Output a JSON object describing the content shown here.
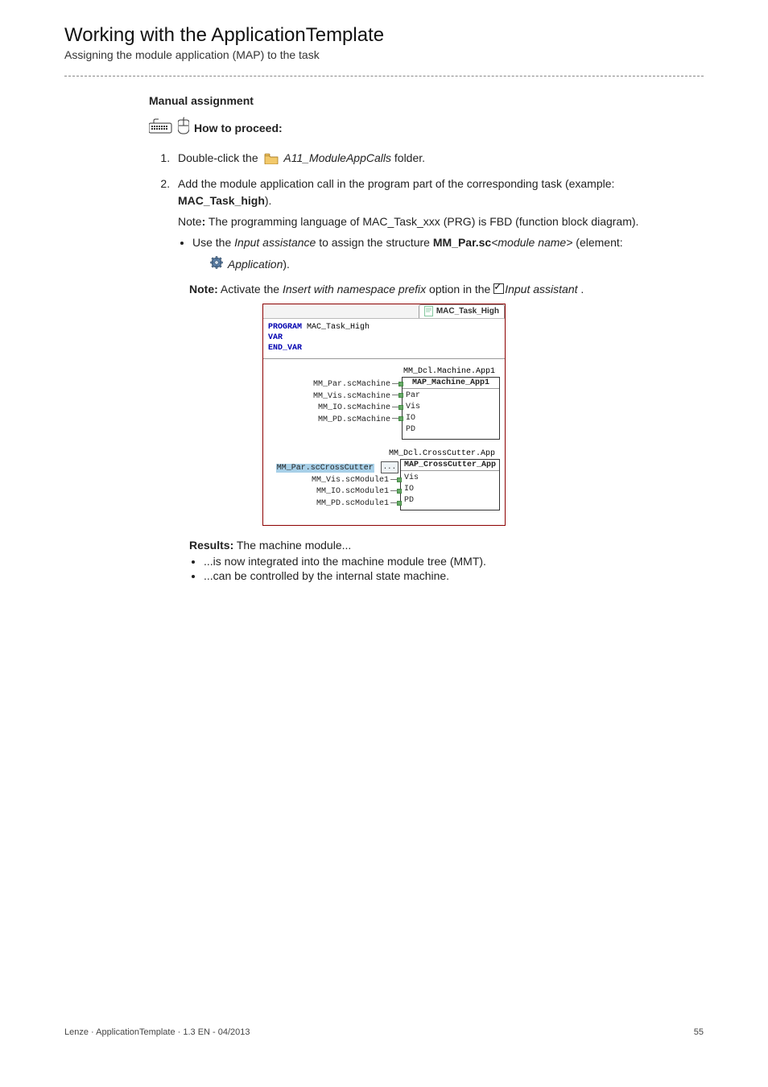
{
  "header": {
    "title": "Working with the ApplicationTemplate",
    "subtitle": "Assigning the module application (MAP) to the task"
  },
  "section": {
    "manual_assignment": "Manual assignment",
    "how_to_proceed": "How to proceed:"
  },
  "steps": {
    "s1_a": "Double-click the ",
    "s1_b_italic": "A11_ModuleAppCalls",
    "s1_c": " folder.",
    "s2_a": "Add the module application call in the program part of the corresponding task (example: ",
    "s2_b_bold": "MAC_Task_high",
    "s2_c": ").",
    "s2_note_prefix": "Note",
    "s2_note_body": " The programming language of MAC_Task_xxx (PRG) is FBD (function block diagram).",
    "s2_li_a": "Use the ",
    "s2_li_b_italic": "Input assistance",
    "s2_li_c": " to assign the structure ",
    "s2_li_d_bold": "MM_Par.sc",
    "s2_li_e_italic": "<module name>",
    "s2_li_f": " (element:",
    "s2_app_italic": "Application",
    "s2_app_after": ")."
  },
  "note2": {
    "prefix": "Note:",
    "a": " Activate the  ",
    "b_italic": "Insert with namespace prefix",
    "c": " option in the ",
    "d_italic": "Input assistant",
    "e": " ."
  },
  "codefig": {
    "tab": "MAC_Task_High",
    "decl_program": "PROGRAM",
    "decl_name": " MAC_Task_High",
    "decl_var": "VAR",
    "decl_endvar": "END_VAR",
    "block1": {
      "instance": "MM_Dcl.Machine.App1",
      "title": "MAP_Machine_App1",
      "left": [
        "MM_Par.scMachine",
        "MM_Vis.scMachine",
        "MM_IO.scMachine",
        "MM_PD.scMachine"
      ],
      "pins": [
        "Par",
        "Vis",
        "IO",
        "PD"
      ]
    },
    "block2": {
      "instance": "MM_Dcl.CrossCutter.App",
      "title": "MAP_CrossCutter_App",
      "left_first": "MM_Par.scCrossCutter",
      "left_rest": [
        "MM_Vis.scModule1",
        "MM_IO.scModule1",
        "MM_PD.scModule1"
      ],
      "pins": [
        "",
        "Vis",
        "IO",
        "PD"
      ]
    }
  },
  "results": {
    "heading_prefix": "Results:",
    "heading_body": " The machine module...",
    "items": [
      "...is now integrated into the machine module tree (MMT).",
      "...can be controlled by the internal state machine."
    ]
  },
  "footer": {
    "left": "Lenze · ApplicationTemplate · 1.3 EN - 04/2013",
    "right": "55"
  }
}
